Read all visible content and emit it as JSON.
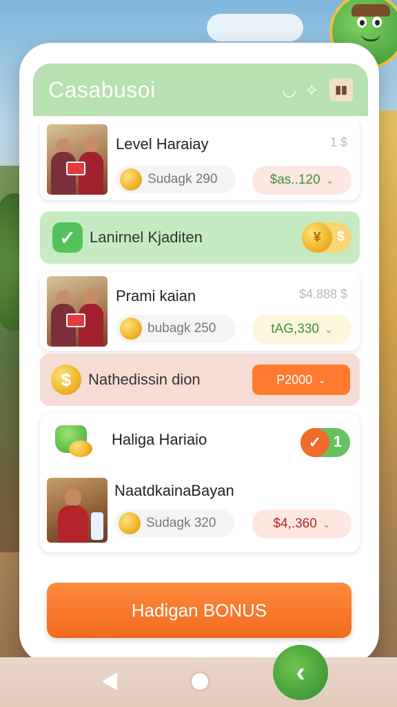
{
  "app": {
    "title": "Casabusoi"
  },
  "header": {
    "icon_search": "◡",
    "icon_arrow": "⟡",
    "icon_bag": "▮▮"
  },
  "items": [
    {
      "title": "Level Haraiay",
      "meta": "1 $",
      "coin_text": "Sudagk 290",
      "price": "$as..120"
    },
    {
      "title": "Prami kaian",
      "meta": "$4.888 $",
      "coin_text": "bubagk 250",
      "price": "tAG,330"
    },
    {
      "title": "NaatdkainaBayan",
      "coin_text": "Sudagk 320",
      "price": "$4,.360"
    }
  ],
  "banners": [
    {
      "label": "Lanirnel Kjaditen"
    },
    {
      "label": "Nathedissin dion",
      "button": "P2000"
    }
  ],
  "task": {
    "title": "Haliga Hariaio",
    "count": "1"
  },
  "bonus_button": "Hadigan BONUS",
  "colors": {
    "accent_green": "#b9e0b0",
    "orange": "#ff7a2f",
    "banner_green": "#c6ebc2",
    "banner_peach": "#f6ddd4"
  }
}
